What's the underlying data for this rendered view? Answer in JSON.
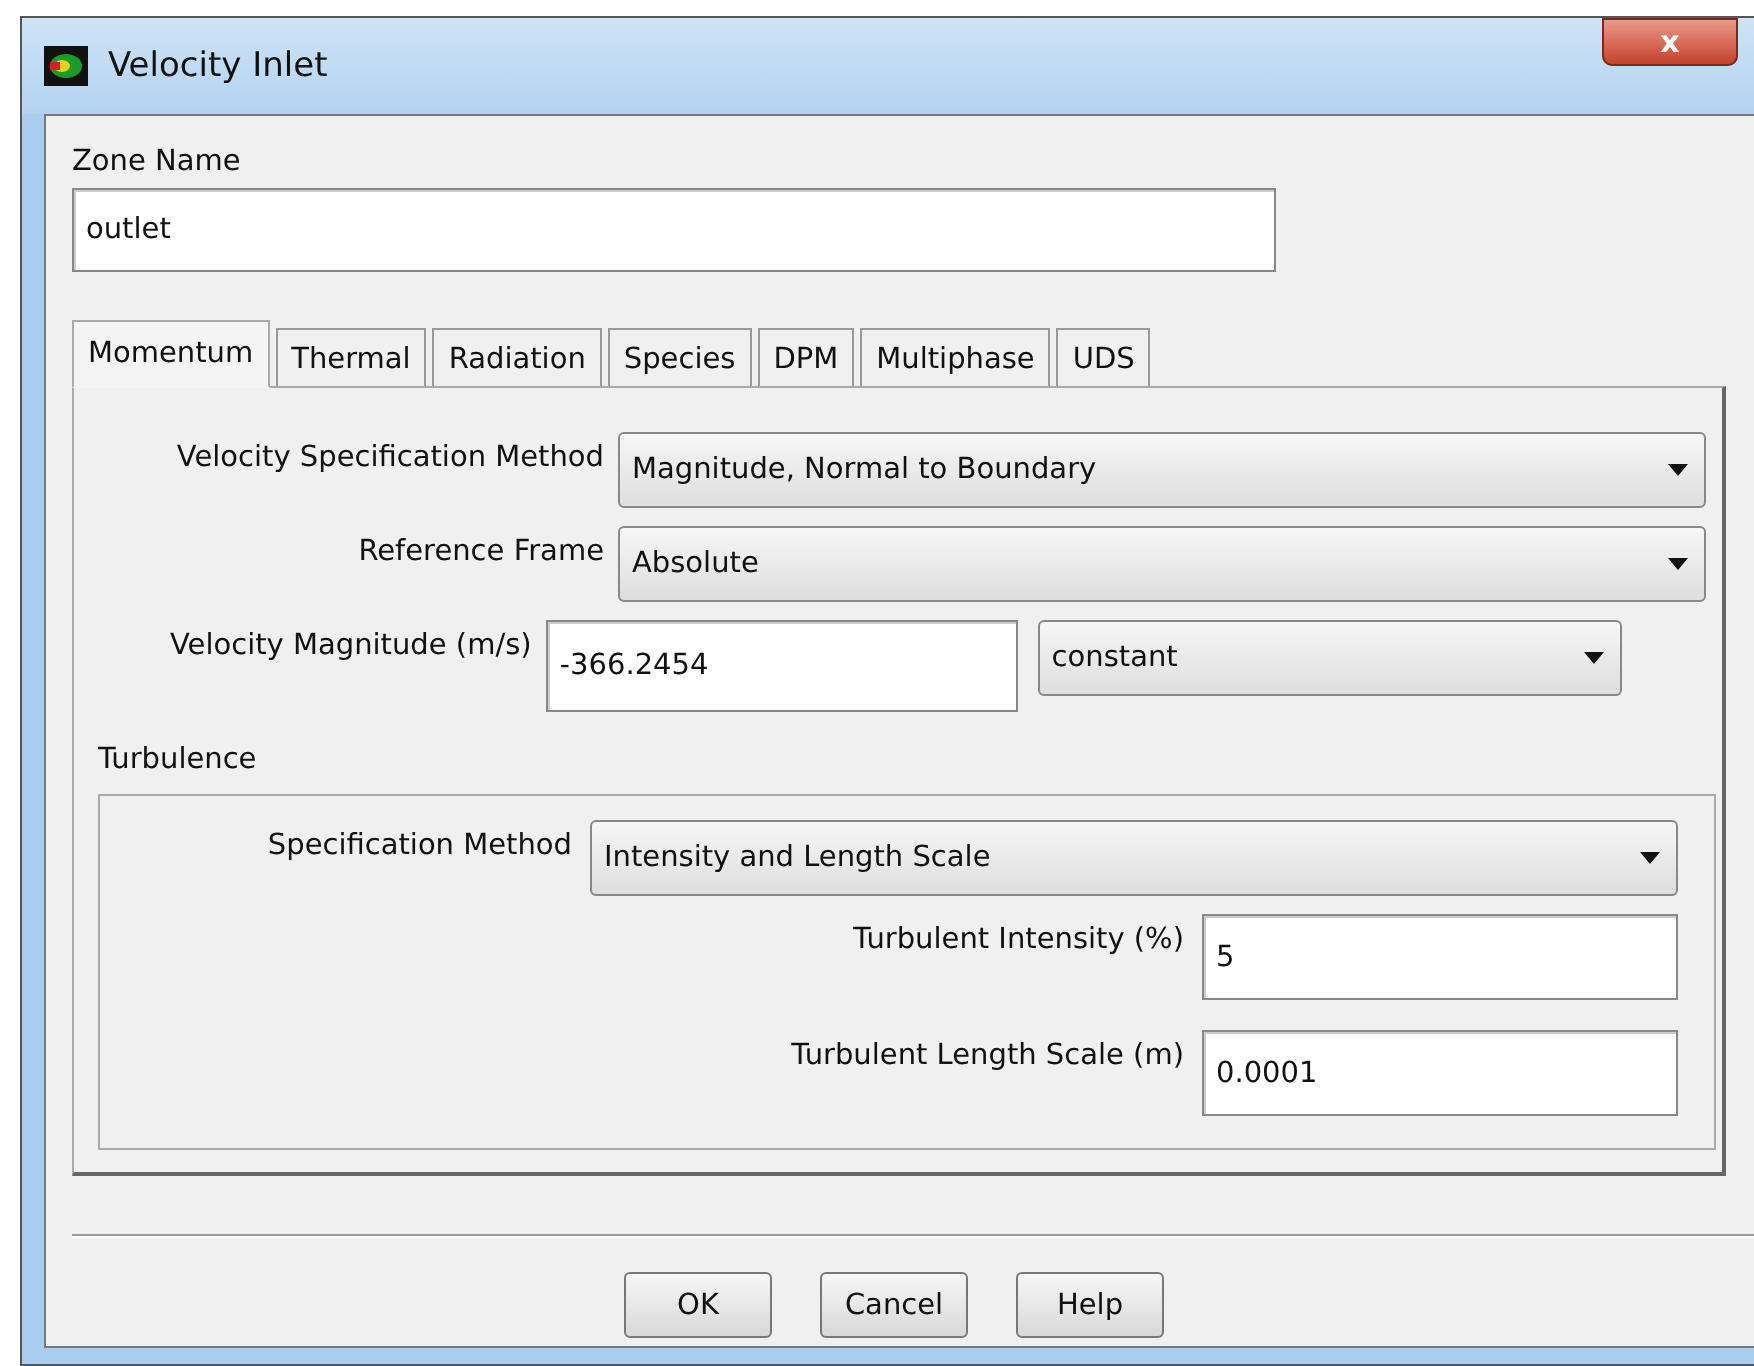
{
  "window": {
    "title": "Velocity Inlet",
    "close": "x"
  },
  "zone_name": {
    "label": "Zone Name",
    "value": "outlet"
  },
  "tabs": [
    {
      "label": "Momentum",
      "selected": true
    },
    {
      "label": "Thermal",
      "selected": false
    },
    {
      "label": "Radiation",
      "selected": false
    },
    {
      "label": "Species",
      "selected": false
    },
    {
      "label": "DPM",
      "selected": false
    },
    {
      "label": "Multiphase",
      "selected": false
    },
    {
      "label": "UDS",
      "selected": false
    }
  ],
  "momentum": [
    {
      "kind": "dropdown",
      "label": "Velocity Specification Method",
      "value": "Magnitude, Normal to Boundary"
    },
    {
      "kind": "dropdown",
      "label": "Reference Frame",
      "value": "Absolute"
    },
    {
      "kind": "input_with_dropdown",
      "label": "Velocity Magnitude (m/s)",
      "value": "-366.2454",
      "option": "constant"
    }
  ],
  "turbulence": {
    "title": "Turbulence",
    "fields": [
      {
        "kind": "dropdown",
        "label": "Specification Method",
        "value": "Intensity and Length Scale"
      },
      {
        "kind": "input",
        "label": "Turbulent Intensity (%)",
        "value": "5"
      },
      {
        "kind": "input",
        "label": "Turbulent Length Scale (m)",
        "value": "0.0001"
      }
    ]
  },
  "buttons": [
    "OK",
    "Cancel",
    "Help"
  ]
}
